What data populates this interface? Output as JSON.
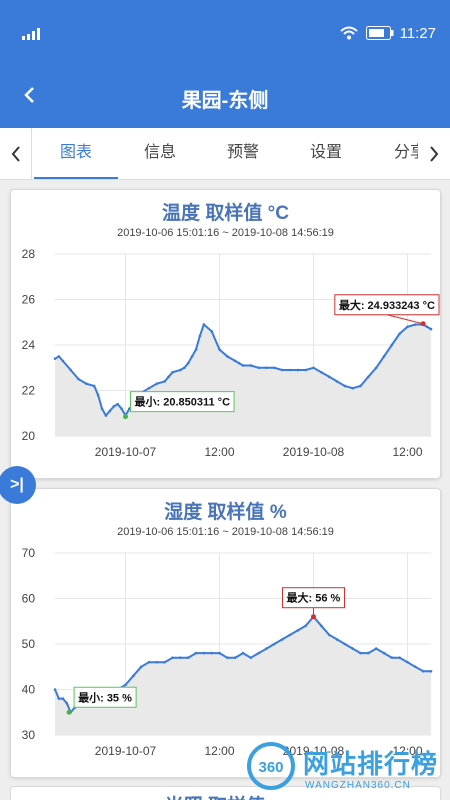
{
  "status": {
    "time": "11:27"
  },
  "appbar": {
    "title": "果园-东侧"
  },
  "tabs": [
    "图表",
    "信息",
    "预警",
    "设置",
    "分享"
  ],
  "charts": [
    {
      "title": "温度 取样值 °C",
      "subtitle": "2019-10-06 15:01:16 ~ 2019-10-08 14:56:19",
      "min_label": "最小: 20.850311 °C",
      "max_label": "最大: 24.933243 °C"
    },
    {
      "title": "湿度 取样值 %",
      "subtitle": "2019-10-06 15:01:16 ~ 2019-10-08 14:56:19",
      "min_label": "最小: 35 %",
      "max_label": "最大: 56 %"
    },
    {
      "title": "光照 取样值 ..."
    }
  ],
  "chart_data": [
    {
      "type": "area",
      "title": "温度 取样值 °C",
      "subtitle": "2019-10-06 15:01:16 ~ 2019-10-08 14:56:19",
      "ylim": [
        20,
        28
      ],
      "yticks": [
        20,
        22,
        24,
        26,
        28
      ],
      "xlim": [
        15.0,
        63.0
      ],
      "xticks": [
        24,
        36,
        48,
        60
      ],
      "xtick_labels": [
        "2019-10-07",
        "12:00",
        "2019-10-08",
        "12:00"
      ],
      "grid": true,
      "color": "#3a7bd9",
      "x": [
        15.0,
        15.5,
        16.0,
        17.0,
        18.0,
        19.0,
        20.0,
        20.5,
        21.0,
        21.5,
        22.0,
        22.5,
        23.0,
        23.5,
        24.0,
        24.5,
        25.0,
        25.5,
        26.0,
        27.0,
        28.0,
        29.0,
        29.5,
        30.0,
        31.0,
        31.5,
        32.0,
        32.5,
        33.0,
        33.5,
        34.0,
        35.0,
        36.0,
        37.0,
        38.0,
        38.5,
        39.0,
        40.0,
        41.0,
        42.0,
        43.0,
        44.0,
        45.0,
        46.0,
        47.0,
        48.0,
        49.0,
        50.0,
        51.0,
        52.0,
        53.0,
        54.0,
        55.0,
        56.0,
        57.0,
        58.0,
        59.0,
        60.0,
        61.0,
        62.0,
        62.5,
        63.0
      ],
      "y": [
        23.4,
        23.5,
        23.3,
        22.9,
        22.5,
        22.3,
        22.2,
        21.8,
        21.2,
        20.9,
        21.1,
        21.3,
        21.4,
        21.2,
        20.9,
        21.2,
        21.4,
        21.6,
        21.9,
        22.1,
        22.3,
        22.4,
        22.6,
        22.8,
        22.9,
        23.0,
        23.2,
        23.5,
        23.8,
        24.4,
        24.9,
        24.6,
        23.8,
        23.5,
        23.3,
        23.2,
        23.1,
        23.1,
        23.0,
        23.0,
        23.0,
        22.9,
        22.9,
        22.9,
        22.9,
        23.0,
        22.8,
        22.6,
        22.4,
        22.2,
        22.1,
        22.2,
        22.6,
        23.0,
        23.5,
        24.0,
        24.5,
        24.8,
        24.9,
        24.9,
        24.8,
        24.7
      ],
      "min": {
        "x": 24.0,
        "y": 20.850311
      },
      "max": {
        "x": 62.0,
        "y": 24.933243
      }
    },
    {
      "type": "area",
      "title": "湿度 取样值 %",
      "subtitle": "2019-10-06 15:01:16 ~ 2019-10-08 14:56:19",
      "ylim": [
        30,
        70
      ],
      "yticks": [
        30,
        40,
        50,
        60,
        70
      ],
      "xlim": [
        15.0,
        63.0
      ],
      "xticks": [
        24,
        36,
        48,
        60
      ],
      "xtick_labels": [
        "2019-10-07",
        "12:00",
        "2019-10-08",
        "12:00"
      ],
      "grid": true,
      "color": "#3a7bd9",
      "x": [
        15.0,
        15.5,
        16.0,
        16.5,
        17.0,
        17.5,
        18.0,
        19.0,
        20.0,
        21.0,
        22.0,
        23.0,
        24.0,
        25.0,
        26.0,
        27.0,
        28.0,
        29.0,
        30.0,
        31.0,
        32.0,
        33.0,
        34.0,
        35.0,
        36.0,
        37.0,
        38.0,
        39.0,
        40.0,
        41.0,
        42.0,
        43.0,
        44.0,
        45.0,
        46.0,
        47.0,
        48.0,
        49.0,
        50.0,
        51.0,
        52.0,
        53.0,
        54.0,
        55.0,
        56.0,
        57.0,
        58.0,
        59.0,
        60.0,
        61.0,
        62.0,
        63.0
      ],
      "y": [
        40,
        38,
        38,
        37,
        35,
        36,
        37,
        37,
        38,
        38,
        39,
        40,
        41,
        43,
        45,
        46,
        46,
        46,
        47,
        47,
        47,
        48,
        48,
        48,
        48,
        47,
        47,
        48,
        47,
        48,
        49,
        50,
        51,
        52,
        53,
        54,
        56,
        54,
        52,
        51,
        50,
        49,
        48,
        48,
        49,
        48,
        47,
        47,
        46,
        45,
        44,
        44
      ],
      "min": {
        "x": 16.8,
        "y": 35
      },
      "max": {
        "x": 48.0,
        "y": 56
      }
    }
  ],
  "watermark": {
    "big": "网站排行榜",
    "small": "WANGZHAN360.CN"
  }
}
